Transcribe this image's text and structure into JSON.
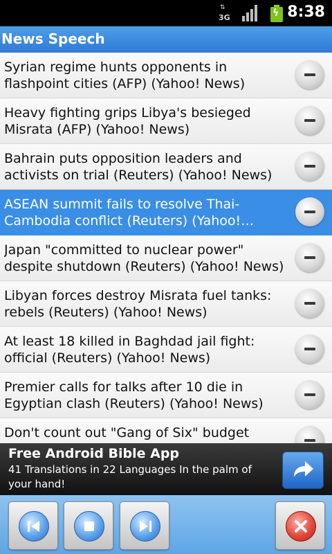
{
  "status_bar": {
    "network": "3G",
    "time": "8:38",
    "icons": [
      "3g-data-icon",
      "signal-strength-icon",
      "battery-charging-icon"
    ]
  },
  "app": {
    "title": "News Speech"
  },
  "news": [
    "Syrian regime hunts opponents in flashpoint cities (AFP) (Yahoo! News)",
    "Heavy fighting grips Libya's besieged Misrata (AFP) (Yahoo! News)",
    "Bahrain puts opposition leaders and activists on trial (Reuters) (Yahoo! News)",
    "ASEAN summit fails to resolve Thai-Cambodia conflict (Reuters) (Yahoo! News...",
    "Japan \"committed to nuclear power\" despite shutdown (Reuters) (Yahoo! News)",
    "Libyan forces destroy Misrata fuel tanks: rebels (Reuters) (Yahoo! News)",
    "At least 18 killed in Baghdad jail fight: official (Reuters) (Yahoo! News)",
    "Premier calls for talks after 10 die in Egyptian clash (Reuters) (Yahoo! News)",
    "Don't count out \"Gang of Six\" budget group"
  ],
  "selected_index": 3,
  "ad": {
    "title": "Free Android Bible App",
    "description": "41 Translations in 22 Languages In the palm of your hand!"
  },
  "controls": [
    "previous-icon",
    "stop-icon",
    "next-icon",
    "close-icon"
  ],
  "colors": {
    "accent": "#3a8ee6",
    "title_bar": "#2f7ad6",
    "controls_bg": "#75b4ea",
    "exit": "#e34a3b"
  }
}
